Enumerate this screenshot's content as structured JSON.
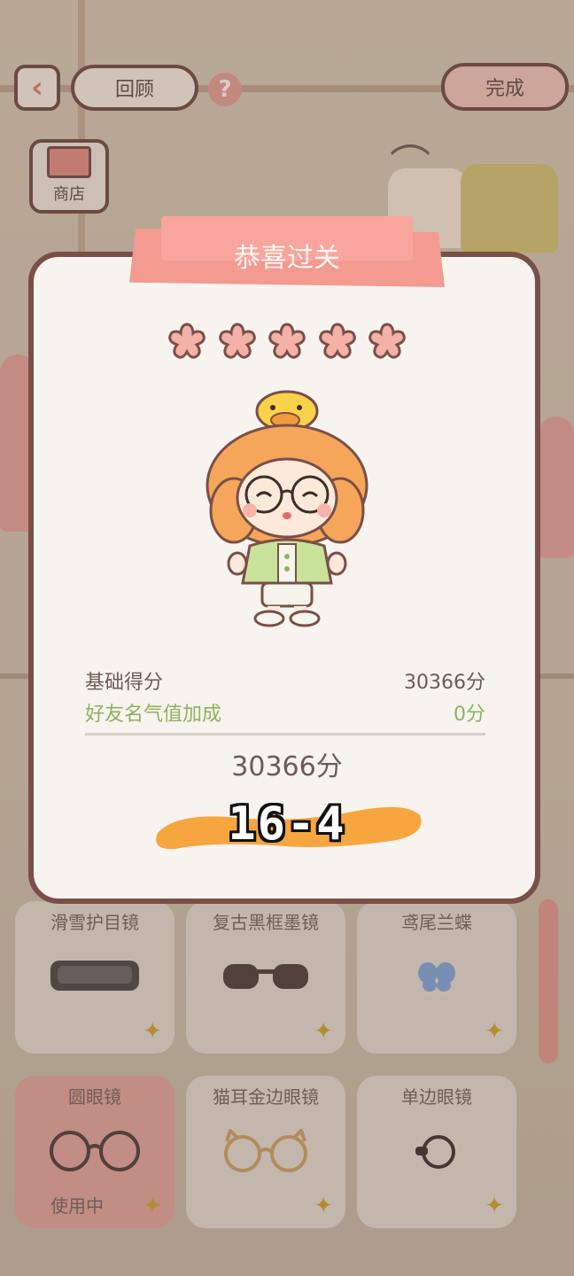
{
  "header": {
    "back_icon": "chevron-left-icon",
    "review_label": "回顾",
    "help_icon": "question-icon",
    "help_glyph": "?",
    "done_label": "完成"
  },
  "shop": {
    "icon": "shop-icon",
    "label": "商店"
  },
  "items": [
    {
      "name": "滑雪护目镜",
      "icon": "ski-goggles-icon"
    },
    {
      "name": "复古黑框墨镜",
      "icon": "sunglasses-icon"
    },
    {
      "name": "鸢尾兰蝶",
      "icon": "butterfly-icon"
    },
    {
      "name": "圆眼镜",
      "icon": "round-glasses-icon",
      "status": "使用中"
    },
    {
      "name": "猫耳金边眼镜",
      "icon": "cat-ear-glasses-icon"
    },
    {
      "name": "单边眼镜",
      "icon": "monocle-icon"
    }
  ],
  "dialog": {
    "title": "恭喜过关",
    "stars": 5,
    "base_label": "基础得分",
    "base_value": "30366分",
    "bonus_label": "好友名气值加成",
    "bonus_value": "0分",
    "total": "30366分",
    "level": "16-4"
  },
  "colors": {
    "accent": "#f39a91",
    "border": "#7a4f48",
    "bonus_green": "#8db35e",
    "level_brush": "#f7a53e"
  }
}
